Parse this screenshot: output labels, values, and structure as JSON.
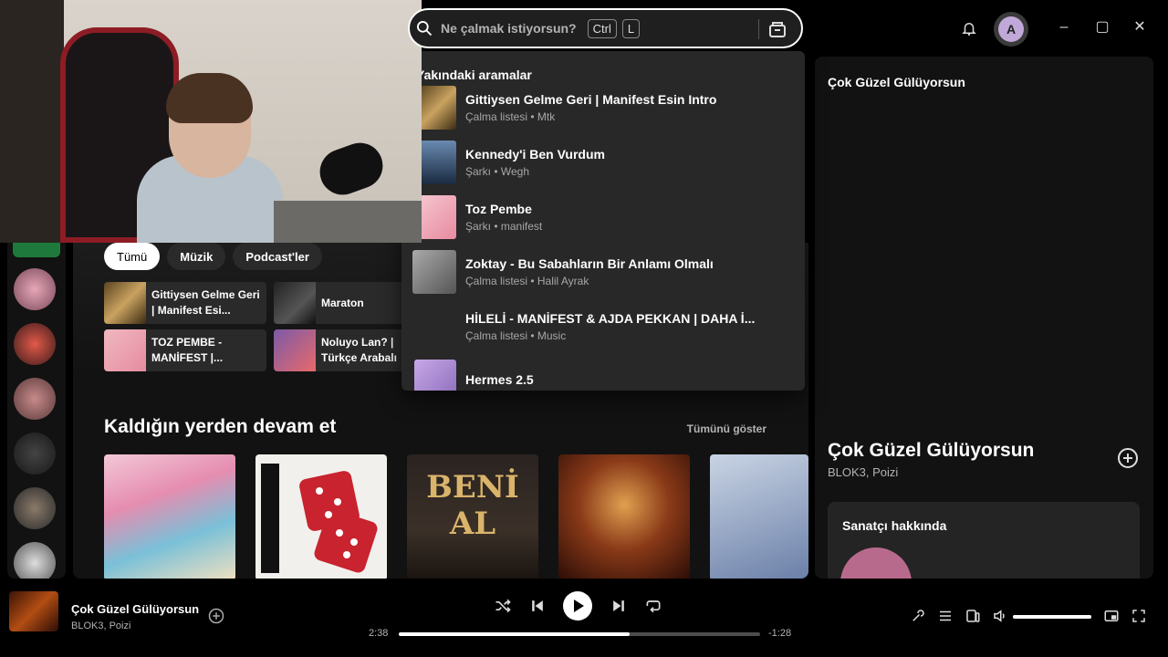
{
  "search": {
    "placeholder": "Ne çalmak istiyorsun?",
    "kbd1": "Ctrl",
    "kbd2": "L"
  },
  "user": {
    "initial": "A"
  },
  "window": {
    "minimize": "–",
    "maximize": "▢",
    "close": "✕"
  },
  "filters": [
    "Tümü",
    "Müzik",
    "Podcast'ler"
  ],
  "quick_items": [
    {
      "title": "Gittiysen Gelme Geri | Manifest Esi..."
    },
    {
      "title": "Maraton"
    },
    {
      "title": "TOZ PEMBE - MANİFEST |..."
    },
    {
      "title": "Noluyo Lan? | Türkçe Arabalı"
    }
  ],
  "section": {
    "title": "Kaldığın yerden devam et",
    "show_all": "Tümünü göster"
  },
  "cards": [
    {
      "text": ""
    },
    {
      "text": ""
    },
    {
      "text": "BENİ AL"
    },
    {
      "text": ""
    },
    {
      "text": ""
    }
  ],
  "recent_searches": {
    "heading": "Yakındaki aramalar",
    "items": [
      {
        "title": "Gittiysen Gelme Geri | Manifest Esin Intro",
        "subtitle": "Çalma listesi • Mtk"
      },
      {
        "title": "Kennedy'i Ben Vurdum",
        "subtitle": "Şarkı • Wegh"
      },
      {
        "title": "Toz Pembe",
        "subtitle": "Şarkı • manifest"
      },
      {
        "title": "Zoktay - Bu Sabahların Bir Anlamı Olmalı",
        "subtitle": "Çalma listesi • Halil Ayrak"
      },
      {
        "title": "HİLELİ - MANİFEST & AJDA PEKKAN | DAHA İ...",
        "subtitle": "Çalma listesi • Music"
      },
      {
        "title": "Hermes 2.5",
        "subtitle": ""
      }
    ]
  },
  "right_panel": {
    "top_title": "Çok Güzel Gülüyorsun",
    "title": "Çok Güzel Gülüyorsun",
    "artists": "BLOK3, Poizi",
    "about_title": "Sanatçı hakkında"
  },
  "now_playing": {
    "title": "Çok Güzel Gülüyorsun",
    "artist": "BLOK3, Poizi",
    "elapsed": "2:38",
    "remaining": "-1:28",
    "progress_fraction": 0.64,
    "volume_fraction": 1.0
  },
  "colors": {
    "accent_green": "#1e7a3c",
    "background": "#121212",
    "dropdown": "#282828"
  }
}
